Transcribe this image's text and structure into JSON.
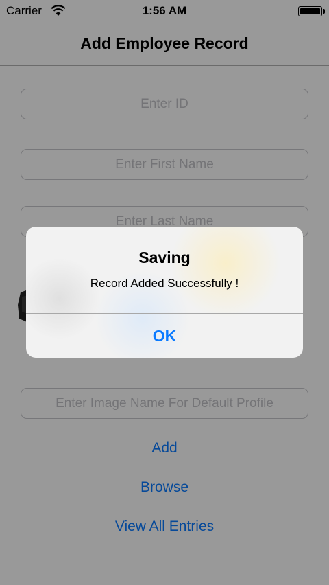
{
  "status_bar": {
    "carrier": "Carrier",
    "time": "1:56 AM",
    "wifi_icon": "wifi-icon",
    "battery_icon": "battery-icon"
  },
  "nav": {
    "title": "Add Employee Record"
  },
  "form": {
    "id_placeholder": "Enter ID",
    "first_name_placeholder": "Enter First Name",
    "last_name_placeholder": "Enter Last Name",
    "image_name_placeholder": "Enter Image Name For Default Profile"
  },
  "actions": {
    "add_label": "Add",
    "browse_label": "Browse",
    "view_all_label": "View All Entries"
  },
  "alert": {
    "title": "Saving",
    "message": "Record Added Successfully !",
    "ok_label": "OK"
  },
  "colors": {
    "accent": "#0a7aff",
    "dim_overlay": "rgba(0,0,0,0.4)",
    "field_border": "#c7c7cc",
    "placeholder": "#c2c2c6"
  }
}
